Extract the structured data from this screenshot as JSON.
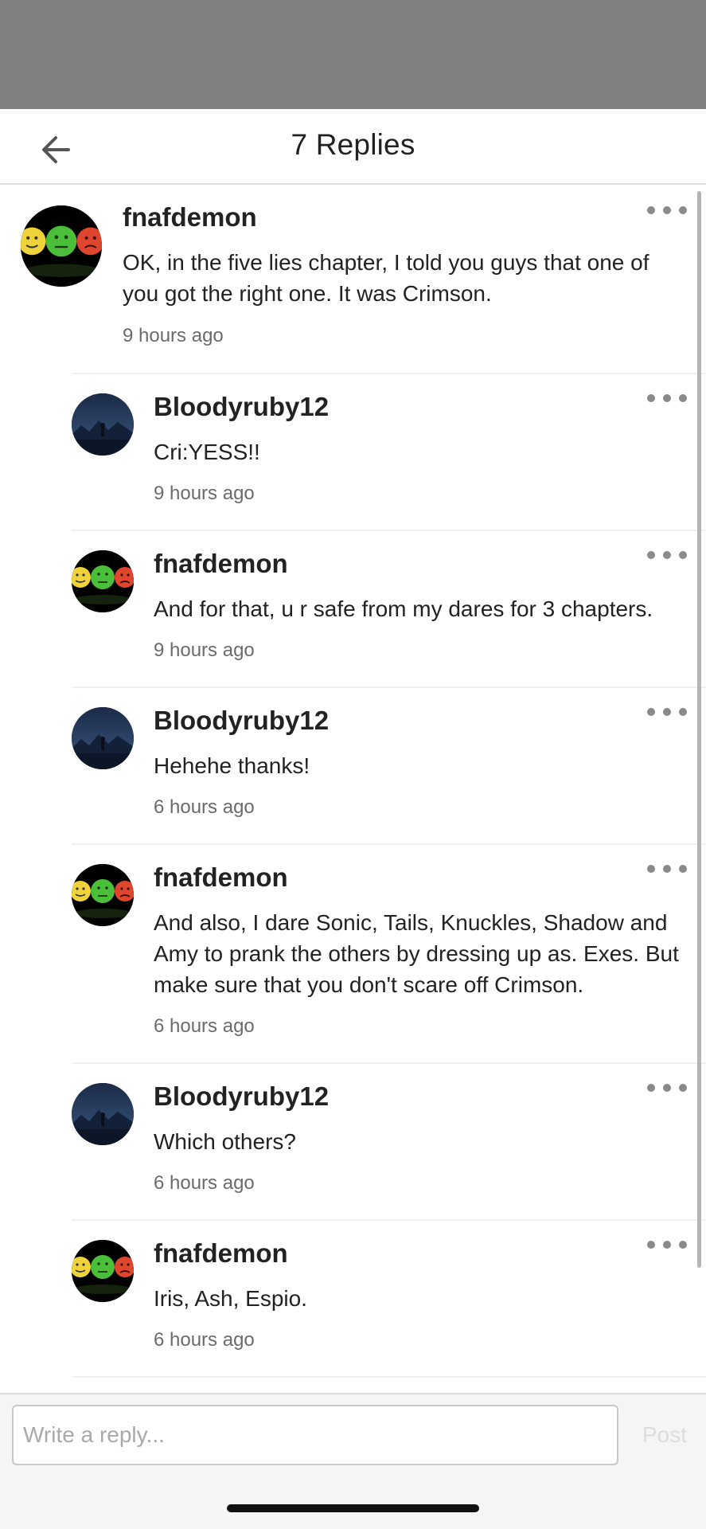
{
  "header": {
    "title": "7 Replies"
  },
  "comments": [
    {
      "author": "fnafdemon",
      "text": "OK, in the five lies chapter, I told you guys that one of you got the right one. It was Crimson.",
      "time": "9 hours ago",
      "avatar": "emoji-faces"
    },
    {
      "author": "Bloodyruby12",
      "text": "Cri:YESS!!",
      "time": "9 hours ago",
      "avatar": "night-mountain"
    },
    {
      "author": "fnafdemon",
      "text": "And for that, u r safe from my dares for 3 chapters.",
      "time": "9 hours ago",
      "avatar": "emoji-faces"
    },
    {
      "author": "Bloodyruby12",
      "text": "Hehehe thanks!",
      "time": "6 hours ago",
      "avatar": "night-mountain"
    },
    {
      "author": "fnafdemon",
      "text": "And also, I dare Sonic, Tails, Knuckles, Shadow and Amy to prank the others by dressing up as. Exes. But make sure that you don't scare off Crimson.",
      "time": "6 hours ago",
      "avatar": "emoji-faces"
    },
    {
      "author": "Bloodyruby12",
      "text": "Which others?",
      "time": "6 hours ago",
      "avatar": "night-mountain"
    },
    {
      "author": "fnafdemon",
      "text": "Iris, Ash, Espio.",
      "time": "6 hours ago",
      "avatar": "emoji-faces"
    }
  ],
  "footer": {
    "placeholder": "Write a reply...",
    "post_label": "Post"
  },
  "colors": {
    "dim_overlay": "#808080",
    "text": "#222222",
    "meta": "#6b6b6b",
    "post_disabled": "#dcdcdc"
  },
  "icons": {
    "back": "arrow-left-icon",
    "more": "more-horizontal-icon"
  }
}
